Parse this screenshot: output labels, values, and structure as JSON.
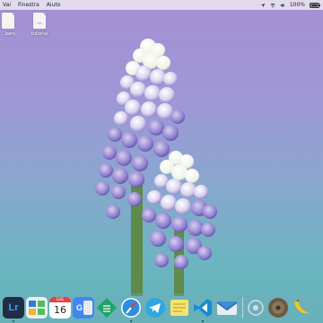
{
  "menubar": {
    "apple": "",
    "menus": [
      "Vai",
      "Finestra",
      "Aiuto"
    ],
    "battery": "100%",
    "status_icons": [
      "location-arrow-icon",
      "wifi-icon",
      "volume-icon",
      "battery-icon"
    ]
  },
  "desktop": {
    "files": [
      {
        "name": "...bers",
        "ext": ""
      },
      {
        "name": "tutorial",
        "ext": "TXT"
      }
    ]
  },
  "calendar": {
    "month": "LUG",
    "day": "16"
  },
  "dock": {
    "apps": [
      "lightroom-icon",
      "mail-app-icon",
      "calendar-icon",
      "google-translate-icon",
      "sheets-icon",
      "safari-icon",
      "telegram-icon",
      "notes-icon",
      "vscode-icon",
      "mail-icon",
      "system-preferences-icon",
      "disk-icon",
      "banana-icon"
    ],
    "lightroom_label": "Lr"
  },
  "colors": {
    "lightroom_bg": "#1f2e44",
    "lightroom_text": "#30a6ff",
    "telegram": "#2fa8e0",
    "vscode": "#1a8ad4",
    "safari": "#2f8de0"
  }
}
